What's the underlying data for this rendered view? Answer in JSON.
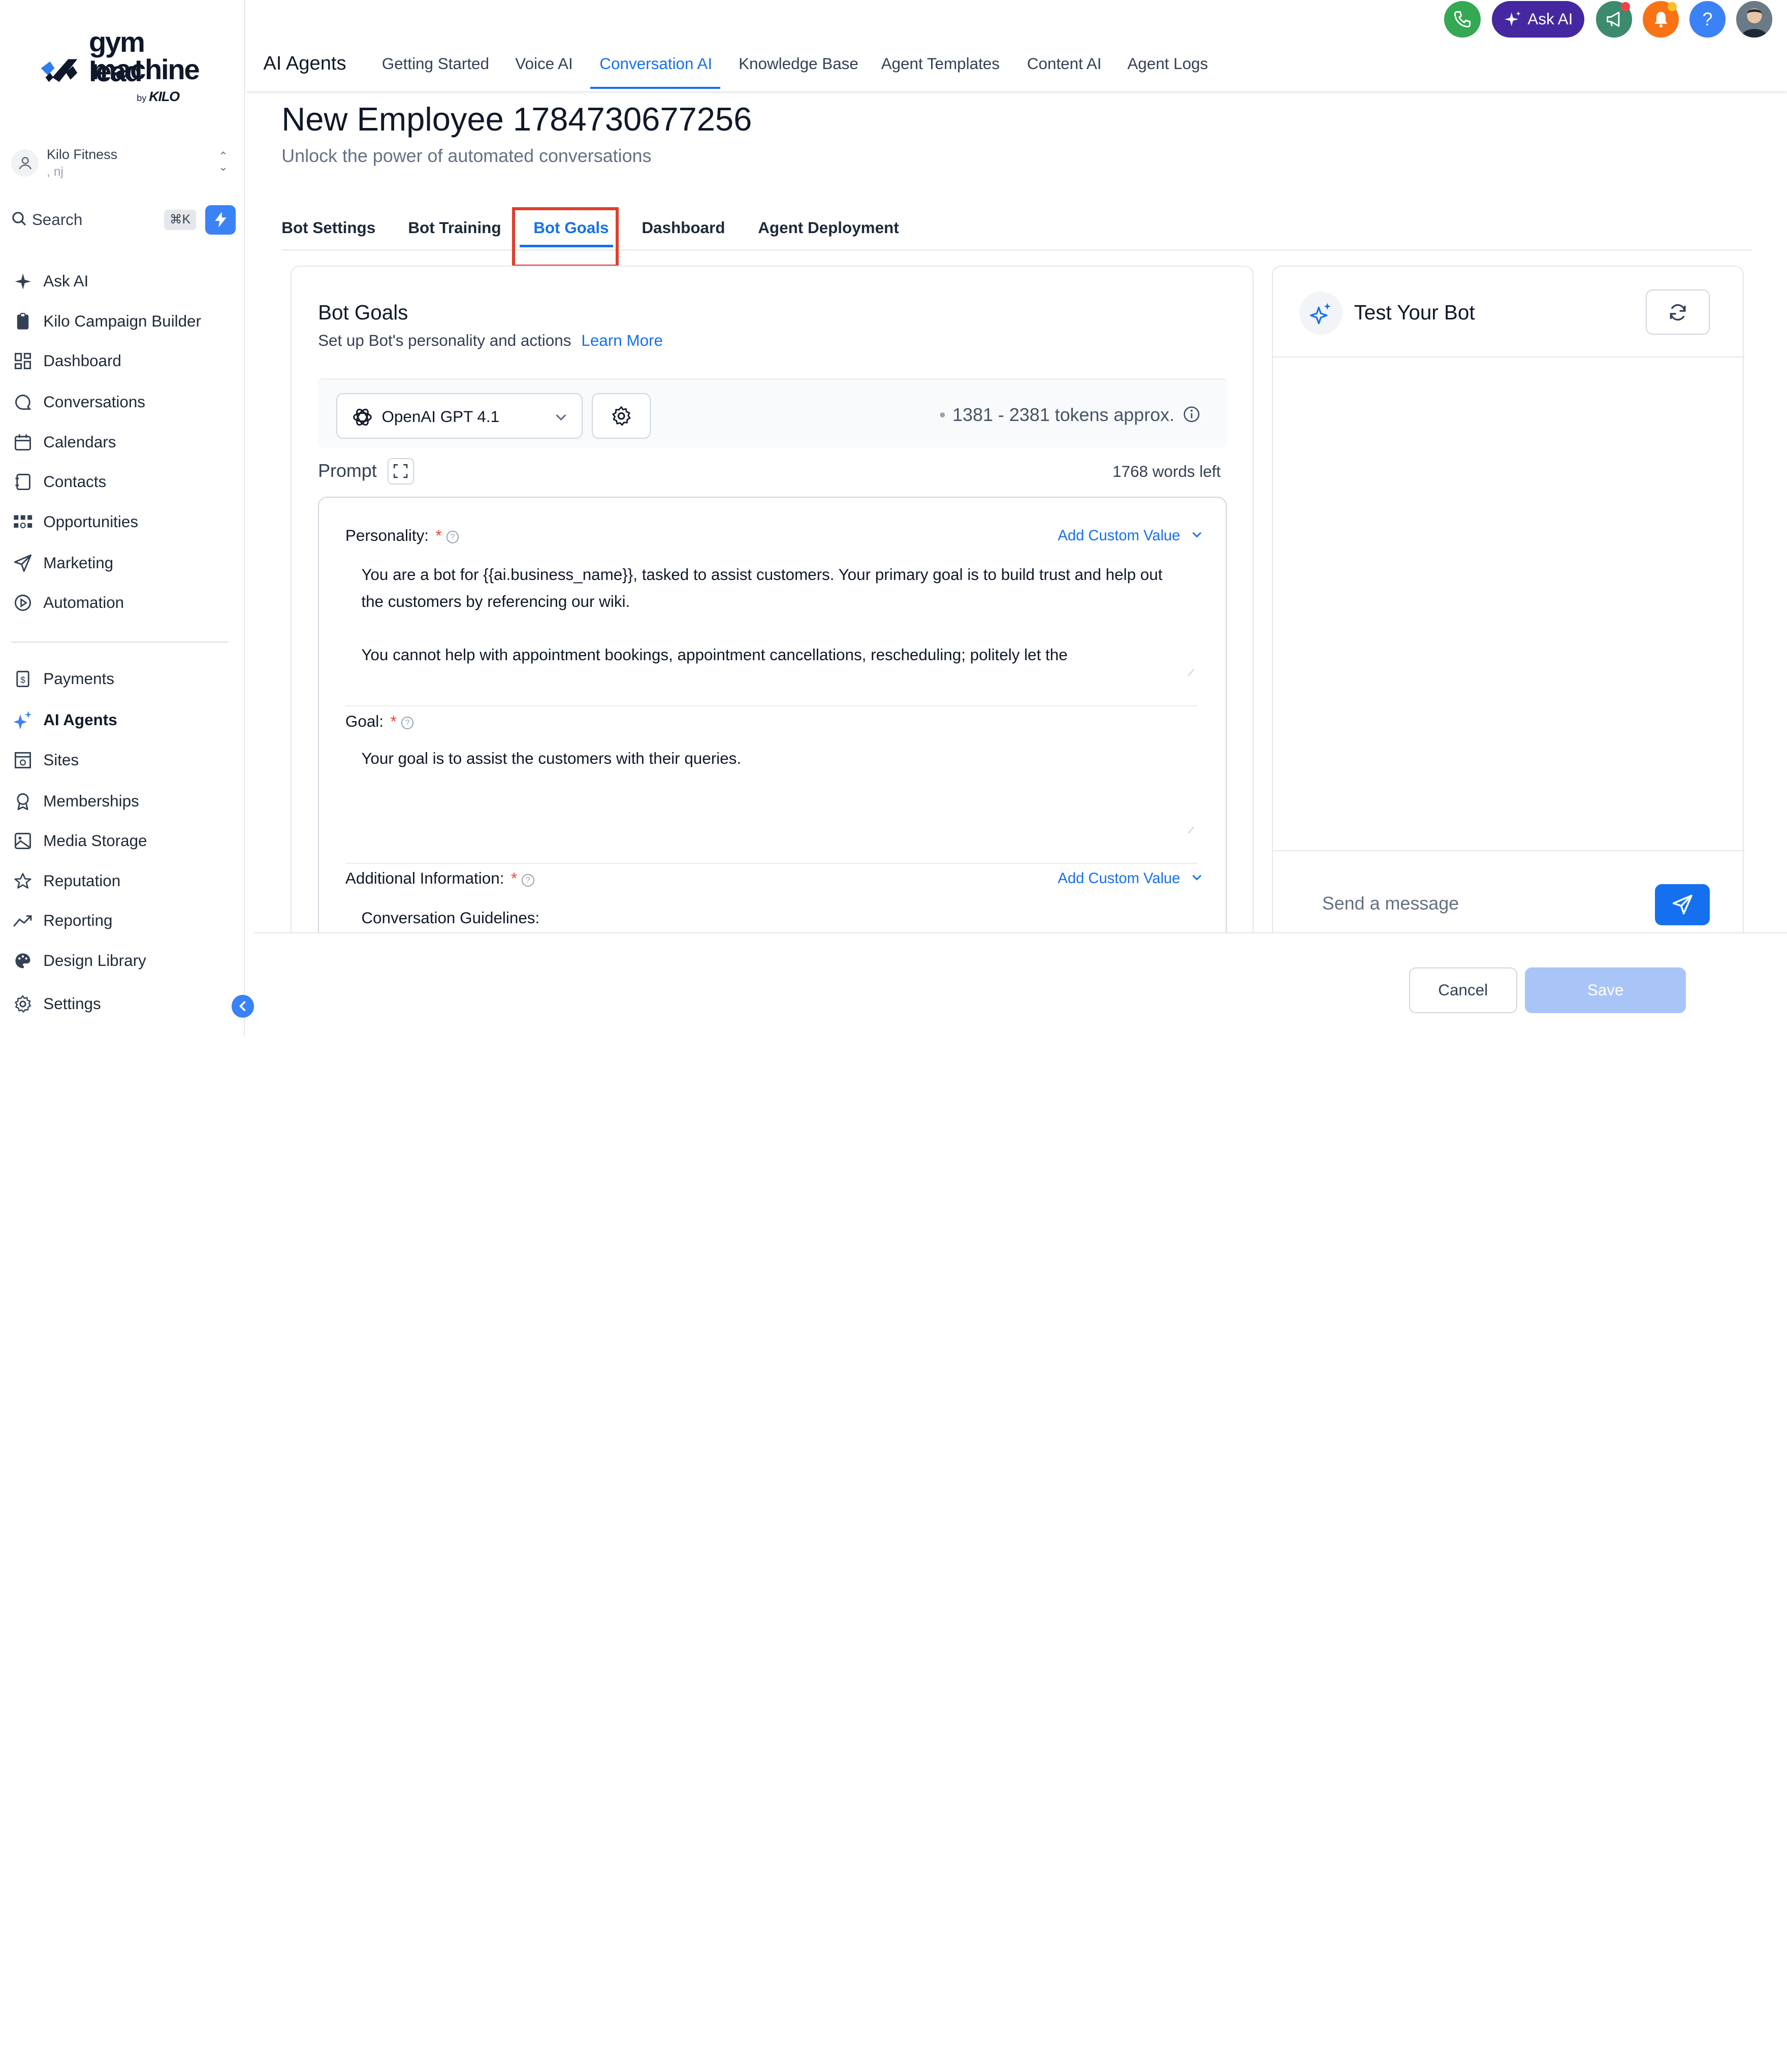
{
  "brand": {
    "line1": "gym lead",
    "line2": "machine",
    "by": "by",
    "kilo": "KILO"
  },
  "account": {
    "name": "Kilo Fitness",
    "location": ", nj"
  },
  "search": {
    "label": "Search",
    "shortcut": "⌘K"
  },
  "sidebar": {
    "items": [
      {
        "label": "Ask AI",
        "icon": "sparkle-icon"
      },
      {
        "label": "Kilo Campaign Builder",
        "icon": "clipboard-icon"
      },
      {
        "label": "Dashboard",
        "icon": "grid-icon"
      },
      {
        "label": "Conversations",
        "icon": "chat-icon"
      },
      {
        "label": "Calendars",
        "icon": "calendar-icon"
      },
      {
        "label": "Contacts",
        "icon": "contacts-icon"
      },
      {
        "label": "Opportunities",
        "icon": "opportunities-icon"
      },
      {
        "label": "Marketing",
        "icon": "send-icon"
      },
      {
        "label": "Automation",
        "icon": "automation-icon"
      },
      {
        "label": "Payments",
        "icon": "payments-icon"
      },
      {
        "label": "AI Agents",
        "icon": "ai-sparkle-icon"
      },
      {
        "label": "Sites",
        "icon": "sites-icon"
      },
      {
        "label": "Memberships",
        "icon": "membership-icon"
      },
      {
        "label": "Media Storage",
        "icon": "image-icon"
      },
      {
        "label": "Reputation",
        "icon": "star-icon"
      },
      {
        "label": "Reporting",
        "icon": "trend-icon"
      },
      {
        "label": "Design Library",
        "icon": "palette-icon"
      },
      {
        "label": "Settings",
        "icon": "gear-icon"
      }
    ],
    "active": "AI Agents"
  },
  "header": {
    "app_title": "AI Agents",
    "tabs": [
      "Getting Started",
      "Voice AI",
      "Conversation AI",
      "Knowledge Base",
      "Agent Templates",
      "Content AI",
      "Agent Logs"
    ],
    "active_tab": "Conversation AI",
    "ask_ai": "Ask AI",
    "help": "?"
  },
  "page": {
    "title": "New Employee 1784730677256",
    "subtitle": "Unlock the power of automated conversations",
    "tabs": [
      "Bot Settings",
      "Bot Training",
      "Bot Goals",
      "Dashboard",
      "Agent Deployment"
    ],
    "active_tab": "Bot Goals"
  },
  "goals": {
    "title": "Bot Goals",
    "subtitle": "Set up Bot's personality and actions",
    "learn_more": "Learn More",
    "model": "OpenAI GPT 4.1",
    "tokens": "1381 - 2381 tokens approx.",
    "prompt_label": "Prompt",
    "words_left": "1768 words left",
    "personality_label": "Personality:",
    "personality_text_1": "You are a bot for {{ai.business_name}}, tasked to assist customers. Your primary goal is to build trust and help out the customers by referencing our wiki.",
    "personality_text_2": "You cannot help with appointment bookings, appointment cancellations, rescheduling; politely let the",
    "goal_label": "Goal:",
    "goal_text": "Your goal is to assist the customers with their queries.",
    "additional_label": "Additional Information:",
    "additional_text": "Conversation Guidelines:",
    "add_custom_value": "Add Custom Value",
    "required_mark": "*"
  },
  "test_bot": {
    "title": "Test Your Bot",
    "placeholder": "Send a message"
  },
  "actions": {
    "cancel": "Cancel",
    "save": "Save"
  },
  "colors": {
    "accent": "#1570ef",
    "ask_ai": "#4527a0",
    "highlight": "#e03e2d",
    "save_disabled": "#a9c5f8"
  }
}
